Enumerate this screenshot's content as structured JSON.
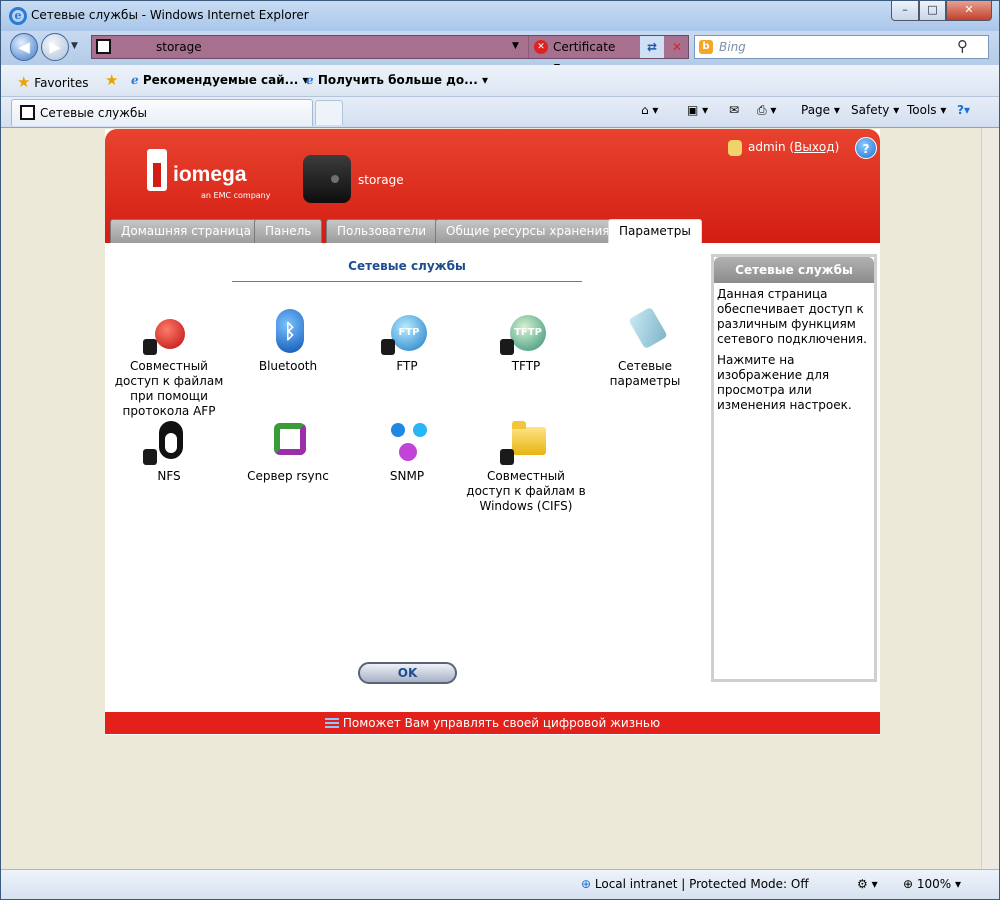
{
  "window": {
    "title": "Сетевые службы - Windows Internet Explorer",
    "min": "–",
    "max": "□",
    "close": "✕"
  },
  "nav": {
    "url": "storage",
    "cert_error": "Certificate Error",
    "search_placeholder": "Bing"
  },
  "favorites_bar": {
    "favorites": "Favorites",
    "items": [
      "Рекомендуемые сай...",
      "Получить больше до..."
    ]
  },
  "tabs": {
    "current": "Сетевые службы"
  },
  "command_bar": {
    "page": "Page",
    "safety": "Safety",
    "tools": "Tools"
  },
  "status": {
    "zone": "Local intranet | Protected Mode: Off",
    "zoom": "100%"
  },
  "app": {
    "logo_name": "iomega",
    "logo_sub": "an EMC company",
    "device_name": "storage",
    "user": "admin",
    "logout": "Выход",
    "nav_tabs": [
      "Домашняя страница",
      "Панель",
      "Пользователи",
      "Общие ресурсы хранения",
      "Параметры"
    ],
    "active_tab": "Параметры",
    "section_title": "Сетевые службы",
    "services": [
      {
        "label": "Совместный доступ к файлам при помощи протокола AFP",
        "icon": "apple-icon"
      },
      {
        "label": "Bluetooth",
        "icon": "bluetooth-icon"
      },
      {
        "label": "FTP",
        "icon": "ftp-globe-icon"
      },
      {
        "label": "TFTP",
        "icon": "tftp-globe-icon"
      },
      {
        "label": "Сетевые параметры",
        "icon": "network-cable-icon"
      },
      {
        "label": "NFS",
        "icon": "penguin-icon"
      },
      {
        "label": "Сервер rsync",
        "icon": "sync-arrows-icon"
      },
      {
        "label": "SNMP",
        "icon": "network-molecule-icon"
      },
      {
        "label": "Совместный доступ к файлам в Windows (CIFS)",
        "icon": "folder-icon"
      }
    ],
    "ok_button": "OK",
    "sidebar": {
      "title": "Сетевые службы",
      "p1": "Данная страница обеспечивает доступ к различным функциям сетевого подключения.",
      "p2": "Нажмите на изображение для просмотра или изменения настроек."
    },
    "footer": "Поможет Вам управлять своей цифровой жизнью"
  }
}
